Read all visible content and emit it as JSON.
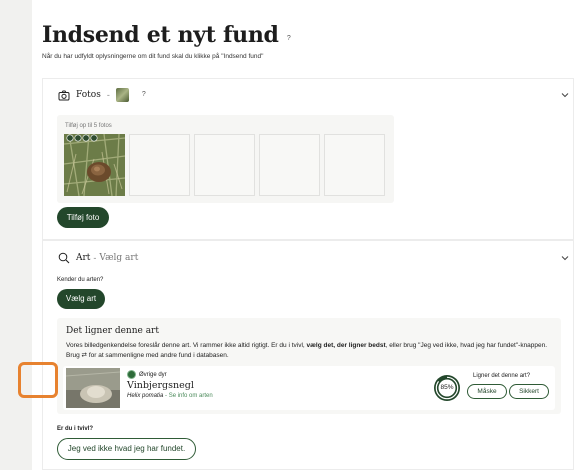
{
  "header": {
    "title": "Indsend et nyt fund",
    "help": "?",
    "subtitle": "Når du har udfyldt oplysningerne om dit fund skal du klikke på \"Indsend fund\""
  },
  "photos": {
    "label": "Fotos",
    "dash": "-",
    "help": "?",
    "hint": "Tilføj op til 5 fotos",
    "add_button": "Tilføj foto",
    "slot_count": 5
  },
  "species": {
    "label": "Art",
    "dash": "-",
    "choose": "Vælg art",
    "know_question": "Kender du arten?",
    "choose_button": "Vælg art",
    "suggestion_title": "Det ligner denne art",
    "suggestion_text_a": "Vores billedgenkendelse foreslår denne art. Vi rammer ikke altid rigtigt. Er du i tvivl,",
    "suggestion_text_bold": "vælg det, der ligner bedst",
    "suggestion_text_b": ", eller brug \"Jeg ved ikke, hvad jeg har fundet\"-knappen. Brug",
    "suggestion_text_icon": "⇄",
    "suggestion_text_c": "for at sammenligne med andre fund i databasen.",
    "candidate": {
      "group": "Øvrige dyr",
      "name": "Vinbjergsnegl",
      "latin": "Helix pomatia",
      "link_sep": "-",
      "link": "Se info om arten",
      "confidence": "85%",
      "confidence_value": 85,
      "question": "Ligner det denne art?",
      "maybe": "Måske",
      "sure": "Sikkert"
    },
    "doubt_label": "Er du i tvivl?",
    "doubt_button": "Jeg ved ikke hvad jeg har fundet."
  },
  "colors": {
    "accent": "#23472b",
    "highlight": "#e7822f"
  }
}
